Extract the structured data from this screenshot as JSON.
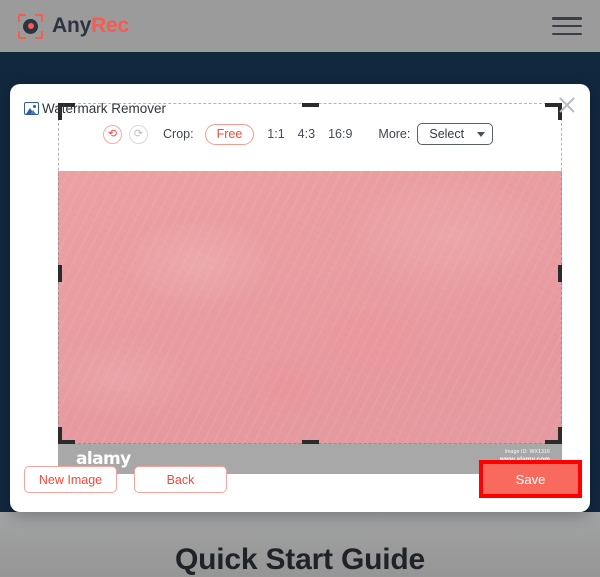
{
  "header": {
    "brand_first": "Any",
    "brand_second": "Rec",
    "logo_icon": "anyrec-camera-logo-icon",
    "menu_icon": "hamburger-menu-icon"
  },
  "modal": {
    "title": "Watermark Remover",
    "title_icon": "image-file-icon",
    "close_icon": "close-x-icon",
    "toolbar": {
      "undo_icon": "undo-arrow-icon",
      "redo_icon": "redo-arrow-icon",
      "crop_label": "Crop:",
      "ratios": [
        {
          "label": "Free",
          "active": true
        },
        {
          "label": "1:1",
          "active": false
        },
        {
          "label": "4:3",
          "active": false
        },
        {
          "label": "16:9",
          "active": false
        }
      ],
      "more_label": "More:",
      "select_value": "Select",
      "select_caret_icon": "chevron-down-icon"
    },
    "image": {
      "alt": "pink textured fabric photo",
      "watermark_logo": "alamy",
      "watermark_id": "Image ID: WX1316",
      "watermark_url": "www.alamy.com"
    },
    "footer": {
      "new_image_label": "New Image",
      "back_label": "Back",
      "save_label": "Save"
    }
  },
  "page": {
    "section_title": "Quick Start Guide"
  },
  "colors": {
    "accent": "#fa5a50",
    "accent_dark": "#f4483a",
    "highlight": "#ff0000",
    "navy": "#12283f",
    "page_grey": "#9b9b9b"
  }
}
